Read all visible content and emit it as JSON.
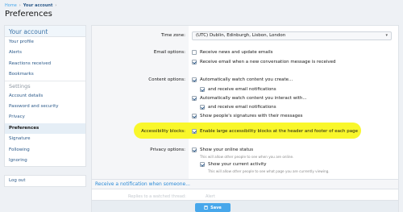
{
  "breadcrumb": {
    "home": "Home",
    "sep": "›",
    "current": "Your account",
    "current_sep": "›"
  },
  "page_title": "Preferences",
  "sidebar": {
    "header": "Your account",
    "items": [
      "Your profile",
      "Alerts",
      "Reactions received",
      "Bookmarks"
    ],
    "section": "Settings",
    "settings_items": [
      "Account details",
      "Password and security",
      "Privacy",
      "Preferences",
      "Signature",
      "Following",
      "Ignoring"
    ],
    "logout": "Log out"
  },
  "form": {
    "time_zone_label": "Time zone:",
    "time_zone_value": "(UTC) Dublin, Edinburgh, Lisbon, London",
    "email_label": "Email options:",
    "email_opts": [
      "Receive news and update emails",
      "Receive email when a new conversation message is received"
    ],
    "content_label": "Content options:",
    "content_opts": [
      "Automatically watch content you create...",
      "and receive email notifications",
      "Automatically watch content you interact with...",
      "and receive email notifications",
      "Show people's signatures with their messages"
    ],
    "access_label": "Accessibility blocks:",
    "access_opt": "Enable large accessibility blocks at the header and footer of each page",
    "privacy_label": "Privacy options:",
    "privacy_opts": [
      "Show your online status",
      "Show your current activity"
    ],
    "privacy_hints": [
      "This will allow other people to see when you are online.",
      "This will allow other people to see what page you are currently viewing."
    ],
    "notify_link": "Receive a notification when someone...",
    "ghost_left": "Replies to a watched thread:",
    "ghost_right": "Alert",
    "save_label": "Save"
  },
  "colors": {
    "accent": "#47a7eb",
    "highlight": "#f9f72b",
    "link": "#2c5a8a"
  }
}
